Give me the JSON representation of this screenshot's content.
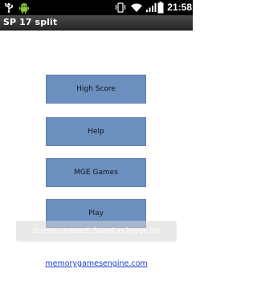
{
  "status_bar": {
    "time": "21:58",
    "icons": [
      "usb-icon",
      "android-debug-icon",
      "vibrate-icon",
      "wifi-icon",
      "signal-icon",
      "battery-icon"
    ]
  },
  "title_bar": {
    "title": "SP 17 split"
  },
  "menu": {
    "buttons": [
      {
        "label": "High Score"
      },
      {
        "label": "Help"
      },
      {
        "label": "MGE Games"
      },
      {
        "label": "Play"
      }
    ]
  },
  "toast": {
    "text": "Screen captured. Saved as image file"
  },
  "footer": {
    "link_text": "memorygamesengine.com"
  },
  "colors": {
    "status_bar_bg": "#000000",
    "title_bar_bg": "#333333",
    "button_bg": "#6b8fbf",
    "link": "#1a3cc8",
    "page_bg": "#ffffff"
  }
}
